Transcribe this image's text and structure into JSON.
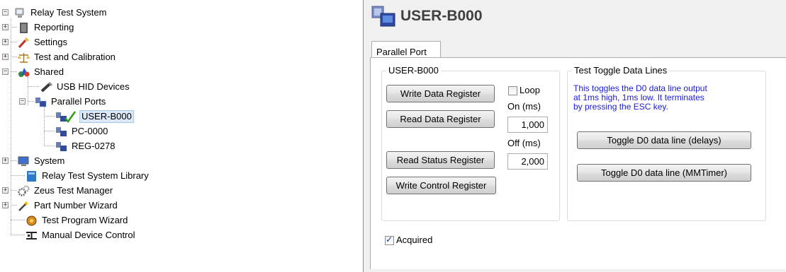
{
  "tree": {
    "root": "Relay Test System",
    "reporting": "Reporting",
    "settings": "Settings",
    "test_calibration": "Test and Calibration",
    "shared": "Shared",
    "usb_hid": "USB HID Devices",
    "parallel_ports": "Parallel Ports",
    "user_b000": "USER-B000",
    "pc_0000": "PC-0000",
    "reg_0278": "REG-0278",
    "system": "System",
    "library": "Relay Test System Library",
    "zeus": "Zeus Test Manager",
    "part_number": "Part Number Wizard",
    "test_program": "Test Program Wizard",
    "manual_device": "Manual Device Control",
    "expander_plus": "+",
    "expander_minus": "−"
  },
  "panel": {
    "title": "USER-B000",
    "tab": "Parallel Port",
    "group1_title": "USER-B000",
    "write_data": "Write Data Register",
    "read_data": "Read Data Register",
    "read_status": "Read Status Register",
    "write_control": "Write Control Register",
    "loop_label": "Loop",
    "loop_checked": false,
    "on_label": "On (ms)",
    "on_value": "1,000",
    "off_label": "Off (ms)",
    "off_value": "2,000",
    "group2_title": "Test Toggle Data Lines",
    "info": "This toggles the D0 data line output\nat 1ms high, 1ms low. It terminates\nby pressing the ESC key.",
    "toggle_delays": "Toggle D0 data line (delays)",
    "toggle_mmtimer": "Toggle D0 data line (MMTimer)",
    "acquired_label": "Acquired",
    "acquired_checked": true
  },
  "colors": {
    "info_text": "#1a1ad6",
    "selection_bg": "#dbe8f8",
    "check_mark": "#27a012"
  }
}
